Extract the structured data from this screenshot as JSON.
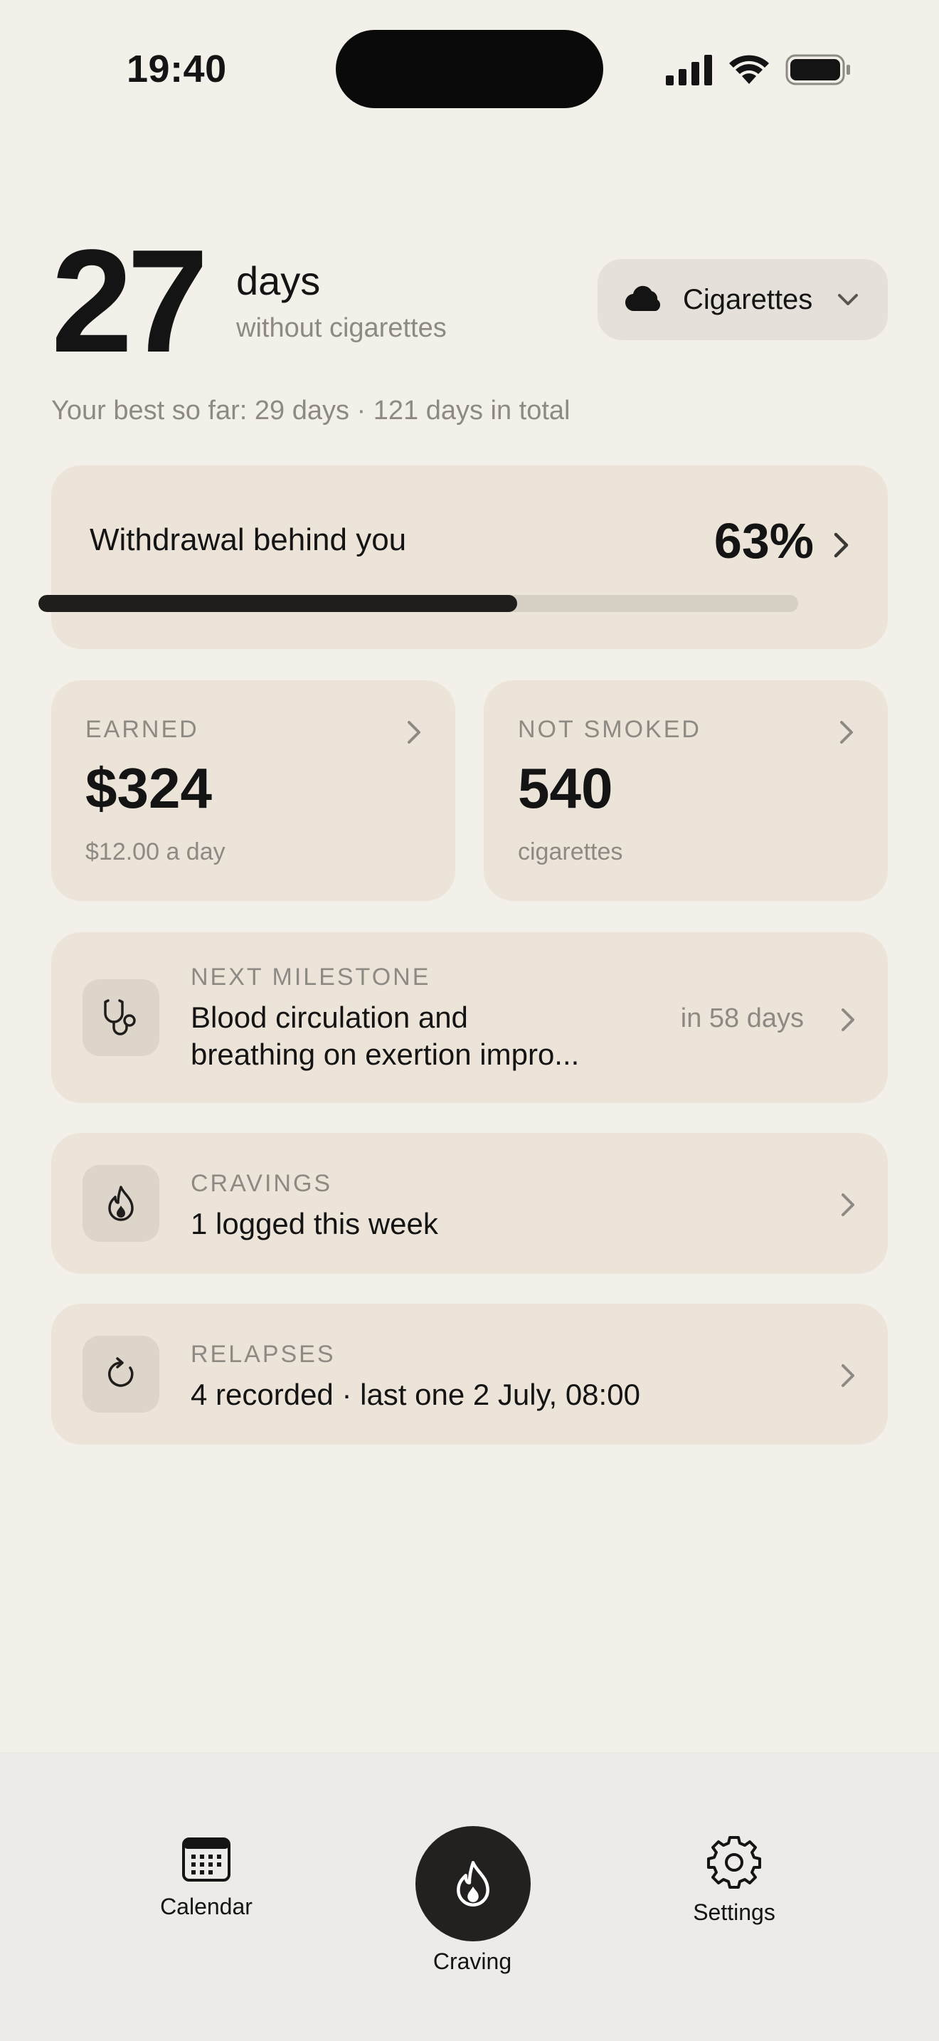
{
  "status_bar": {
    "time": "19:40"
  },
  "header": {
    "days_count": "27",
    "days_unit": "days",
    "days_subtitle": "without cigarettes",
    "substance_label": "Cigarettes",
    "best_line": "Your best so far: 29 days · 121 days in total"
  },
  "withdrawal": {
    "title": "Withdrawal behind you",
    "percent_label": "63%",
    "progress_fraction": 0.63
  },
  "earned": {
    "caption": "EARNED",
    "value": "$324",
    "sub": "$12.00 a day"
  },
  "not_smoked": {
    "caption": "NOT SMOKED",
    "value": "540",
    "sub": "cigarettes"
  },
  "milestone": {
    "caption": "NEXT MILESTONE",
    "line1": "Blood circulation and",
    "line2": "breathing on exertion impro...",
    "eta": "in 58 days"
  },
  "cravings": {
    "caption": "CRAVINGS",
    "text": "1 logged this week"
  },
  "relapses": {
    "caption": "RELAPSES",
    "text": "4 recorded · last one 2 July, 08:00"
  },
  "tabbar": {
    "calendar": "Calendar",
    "craving": "Craving",
    "settings": "Settings"
  },
  "icons": {
    "cloud": "cloud-icon",
    "chevron_down": "chevron-down-icon",
    "chevron_right": "chevron-right-icon",
    "stethoscope": "stethoscope-icon",
    "flame": "flame-icon",
    "refresh": "refresh-icon",
    "calendar": "calendar-icon",
    "gear": "gear-icon"
  },
  "colors": {
    "background": "#f3efe9",
    "card": "#ece4d8",
    "progress_fill": "#1f1e1c",
    "muted_text": "#8d8983"
  }
}
